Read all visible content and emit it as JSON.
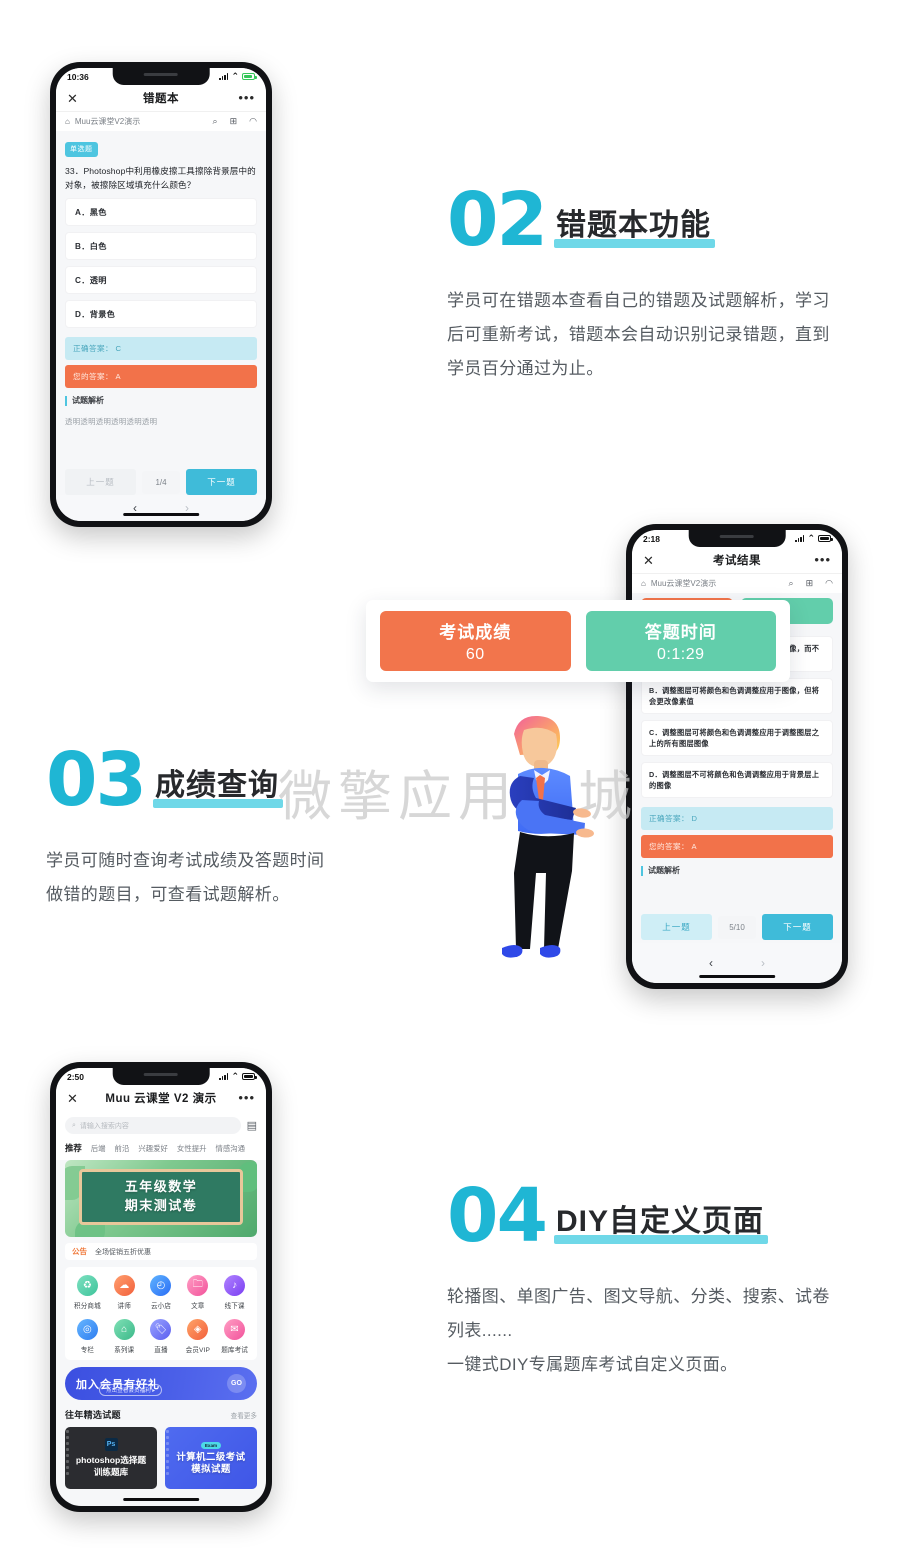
{
  "watermark": "微擎应用商城",
  "sections": {
    "s02": {
      "number": "02",
      "title": "错题本功能",
      "body": [
        "学员可在错题本查看自己的错题及试题解析，学习",
        "后可重新考试，错题本会自动识别记录错题，直到",
        "学员百分通过为止。"
      ]
    },
    "s03": {
      "number": "03",
      "title": "成绩查询",
      "body": [
        "学员可随时查询考试成绩及答题时间",
        "做错的题目，可查看试题解析。"
      ]
    },
    "s04": {
      "number": "04",
      "title": "DIY自定义页面",
      "body": [
        "轮播图、单图广告、图文导航、分类、搜索、试卷",
        "列表......",
        "一键式DIY专属题库考试自定义页面。"
      ]
    }
  },
  "phone1": {
    "status_time": "10:36",
    "nav": {
      "close": "✕",
      "title": "错题本",
      "more": "•••"
    },
    "subbar": {
      "home_icon": "⌂",
      "brand": "Muu云课堂V2演示",
      "search_icon": "⌕",
      "scan_icon": "⊞",
      "user_icon": "◠"
    },
    "tag": "单选题",
    "question": "33．Photoshop中利用橡皮擦工具擦除背景层中的对象，被擦除区域填充什么颜色？",
    "options": [
      "A．黑色",
      "B．白色",
      "C．透明",
      "D．背景色"
    ],
    "correct_label": "正确答案：",
    "correct_value": "C",
    "yours_label": "您的答案：",
    "yours_value": "A",
    "analysis_title": "试题解析",
    "analysis_text": "透明透明透明透明透明透明",
    "prev": "上一题",
    "count": "1/4",
    "next": "下一题",
    "tab_prev": "‹",
    "tab_next": "›"
  },
  "phone2": {
    "status_time": "2:18",
    "nav": {
      "close": "✕",
      "title": "考试结果",
      "more": "•••"
    },
    "subbar": {
      "home_icon": "⌂",
      "brand": "Muu云课堂V2演示",
      "search_icon": "⌕",
      "scan_icon": "⊞",
      "user_icon": "◠"
    },
    "options": [
      "A．调整图层可将颜色和色调调整应用于图像，而不会更改像素值",
      "B．调整图层可将颜色和色调调整应用于图像，但将会更改像素值",
      "C．调整图层可将颜色和色调调整应用于调整图层之上的所有图层图像",
      "D．调整图层不可将颜色和色调调整应用于背景层上的图像"
    ],
    "correct_label": "正确答案：",
    "correct_value": "D",
    "yours_label": "您的答案：",
    "yours_value": "A",
    "analysis_title": "试题解析",
    "prev": "上一题",
    "count": "5/10",
    "next": "下一题",
    "tab_prev": "‹",
    "tab_next": "›"
  },
  "score_card": {
    "exam": {
      "label": "考试成绩",
      "value": "60",
      "color": "#f2754c"
    },
    "time": {
      "label": "答题时间",
      "value": "0:1:29",
      "color": "#62ceab"
    }
  },
  "phone3": {
    "status_time": "2:50",
    "nav": {
      "close": "✕",
      "title": "Muu 云课堂 V2 演示",
      "more": "•••"
    },
    "search": {
      "icon": "⌕",
      "placeholder": "请输入搜索内容",
      "calendar_icon": "▤"
    },
    "cat_tabs": [
      "推荐",
      "后端",
      "前沿",
      "兴趣爱好",
      "女性提升",
      "情感沟通"
    ],
    "banner": {
      "line1": "五年级数学",
      "line2": "期末测试卷"
    },
    "notice": {
      "tag": "公告",
      "text": "全场促销五折优惠"
    },
    "grid": [
      {
        "label": "积分商城",
        "icon": "♻",
        "c1": "#7de0c0",
        "c2": "#3ec49b"
      },
      {
        "label": "讲师",
        "icon": "☁",
        "c1": "#ff9f6e",
        "c2": "#f2603c"
      },
      {
        "label": "云小店",
        "icon": "◴",
        "c1": "#5fb4ff",
        "c2": "#2a6df5"
      },
      {
        "label": "文章",
        "icon": "🗀",
        "c1": "#ff9ec4",
        "c2": "#f2539b"
      },
      {
        "label": "线下课",
        "icon": "♪",
        "c1": "#b083ff",
        "c2": "#7b3ff2"
      },
      {
        "label": "专栏",
        "icon": "◎",
        "c1": "#66b6ff",
        "c2": "#2f7df0"
      },
      {
        "label": "系列课",
        "icon": "⌂",
        "c1": "#7fe0b5",
        "c2": "#3cb98a"
      },
      {
        "label": "直播",
        "icon": "🏷",
        "c1": "#9aa4ff",
        "c2": "#5b5ef0"
      },
      {
        "label": "会员VIP",
        "icon": "◈",
        "c1": "#ffa468",
        "c2": "#f2603c"
      },
      {
        "label": "题库考试",
        "icon": "✉",
        "c1": "#ff9ec4",
        "c2": "#f2539b"
      }
    ],
    "vip": {
      "title": "加入会员有好礼",
      "sub": "点击查看会员福利 ▸",
      "go": "GO"
    },
    "list_header": {
      "title": "往年精选试题",
      "more": "查看更多"
    },
    "cards": [
      {
        "badge": "Ps",
        "line1": "photoshop选择题",
        "line2": "训练题库",
        "style": "dark"
      },
      {
        "chip": "Exam",
        "line1": "计算机二级考试",
        "line2": "模拟试题",
        "style": "blue"
      }
    ]
  }
}
